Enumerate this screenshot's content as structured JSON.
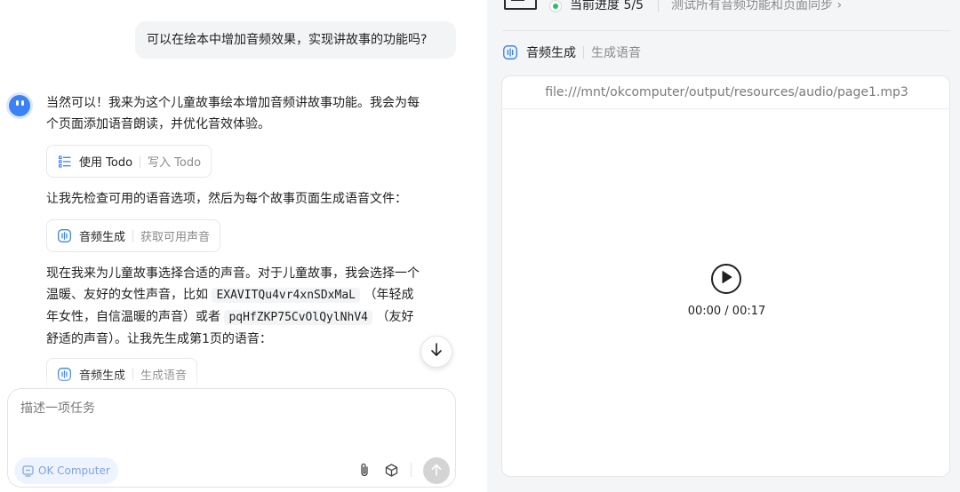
{
  "chat": {
    "user_message": "可以在绘本中增加音频效果，实现讲故事的功能吗?",
    "messages": {
      "p1_line1": "当然可以！我来为这个儿童故事绘本增加音频讲故事功能。我会为每",
      "p1_line2": "个页面添加语音朗读，并优化音效体验。",
      "p2": "让我先检查可用的语音选项，然后为每个故事页面生成语音文件：",
      "p3_line1": "现在我来为儿童故事选择合适的声音。对于儿童故事，我会选择一个",
      "p3_line2_a": "温暖、友好的女性声音，比如",
      "p3_code1": "EXAVITQu4vr4xnSDxMaL",
      "p3_line2_b": "（年轻成",
      "p3_line3_a": "年女性，自信温暖的声音）或者",
      "p3_code2": "pqHfZKP75CvOlQylNhV4",
      "p3_line3_b": "（友好",
      "p3_line4": "舒适的声音）。让我先生成第1页的语音："
    },
    "tools": [
      {
        "name": "使用 Todo",
        "desc": "写入 Todo",
        "icon": "checklist-icon"
      },
      {
        "name": "音频生成",
        "desc": "获取可用声音",
        "icon": "audio-wave-icon"
      },
      {
        "name": "音频生成",
        "desc": "生成语音",
        "icon": "audio-wave-icon"
      }
    ],
    "composer": {
      "placeholder": "描述一项任务",
      "mode_chip": "OK Computer"
    }
  },
  "panel": {
    "progress_label": "当前进度 5/5",
    "step_desc": "测试所有音频功能和页面同步 ›",
    "tool_name": "音频生成",
    "tool_desc": "生成语音",
    "file_path": "file:///mnt/okcomputer/output/resources/audio/page1.mp3",
    "time_readout": "00:00 / 00:17"
  },
  "colors": {
    "accent": "#3b82f6",
    "progress_dot": "#22c55e",
    "panel_bg": "#f4f5f7"
  }
}
